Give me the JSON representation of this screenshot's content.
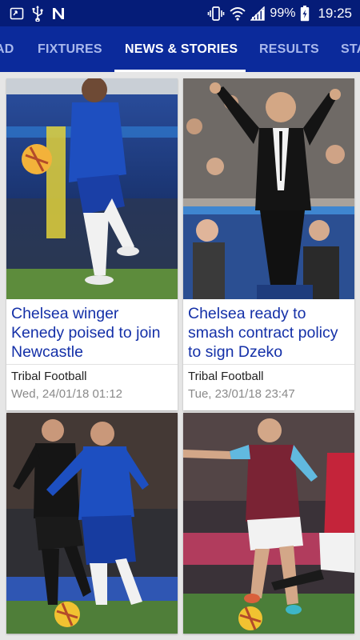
{
  "status_bar": {
    "battery": "99%",
    "time": "19:25",
    "icons_left": [
      "screen-cast-icon",
      "usb-icon",
      "n-app-icon"
    ],
    "icons_right": [
      "vibrate-icon",
      "wifi-icon",
      "signal-icon",
      "battery-charging-icon"
    ]
  },
  "tabs": [
    {
      "label": "AD"
    },
    {
      "label": "FIXTURES"
    },
    {
      "label": "NEWS & STORIES"
    },
    {
      "label": "RESULTS"
    },
    {
      "label": "STA"
    }
  ],
  "active_tab": "NEWS & STORIES",
  "colors": {
    "status_bar": "#051c78",
    "tab_bar": "#0b2a9b",
    "title_blue": "#1430a8"
  },
  "articles": [
    {
      "title": "Chelsea winger Kenedy poised to join Newcastle",
      "source": "Tribal Football",
      "date": "Wed, 24/01/18 01:12"
    },
    {
      "title": "Chelsea ready to smash contract policy to sign Dzeko",
      "source": "Tribal Football",
      "date": "Tue, 23/01/18 23:47"
    },
    {
      "title": "",
      "source": "",
      "date": ""
    },
    {
      "title": "",
      "source": "",
      "date": ""
    }
  ]
}
